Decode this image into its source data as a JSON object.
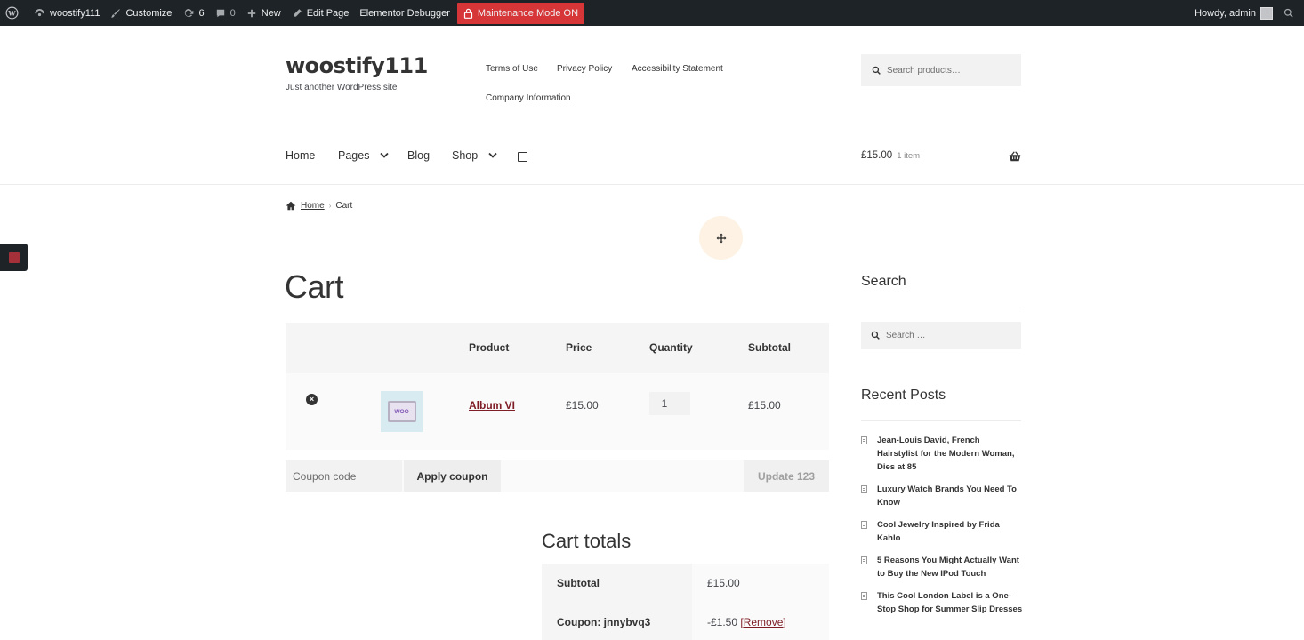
{
  "adminbar": {
    "site_name": "woostify111",
    "customize": "Customize",
    "updates_count": "6",
    "comments_count": "0",
    "new": "New",
    "edit_page": "Edit Page",
    "elementor_debugger": "Elementor Debugger",
    "maintenance": "Maintenance Mode ON",
    "howdy": "Howdy, admin"
  },
  "header": {
    "site_title": "woostify111",
    "tagline": "Just another WordPress site",
    "secondary_nav": [
      "Terms of Use",
      "Privacy Policy",
      "Accessibility Statement",
      "Company Information"
    ],
    "search_placeholder": "Search products…"
  },
  "nav": {
    "home": "Home",
    "pages": "Pages",
    "blog": "Blog",
    "shop": "Shop",
    "cart_amount": "£15.00",
    "cart_count": "1 item"
  },
  "breadcrumb": {
    "home": "Home",
    "current": "Cart"
  },
  "cart": {
    "title": "Cart",
    "columns": {
      "product": "Product",
      "price": "Price",
      "quantity": "Quantity",
      "subtotal": "Subtotal"
    },
    "items": [
      {
        "name": "Album VI",
        "thumb_text": "WOO",
        "price": "£15.00",
        "quantity": "1",
        "subtotal": "£15.00"
      }
    ],
    "coupon_placeholder": "Coupon code",
    "apply_coupon": "Apply coupon",
    "update_cart": "Update 123"
  },
  "totals": {
    "title": "Cart totals",
    "subtotal_label": "Subtotal",
    "subtotal_value": "£15.00",
    "coupon_label": "Coupon: jnnybvq3",
    "coupon_value": "-£1.50",
    "remove_label": "[Remove]"
  },
  "sidebar": {
    "search_title": "Search",
    "search_placeholder": "Search …",
    "recent_title": "Recent Posts",
    "posts": [
      "Jean-Louis David, French Hairstylist for the Modern Woman, Dies at 85",
      "Luxury Watch Brands You Need To Know",
      "Cool Jewelry Inspired by Frida Kahlo",
      "5 Reasons You Might Actually Want to Buy the New IPod Touch",
      "This Cool London Label is a One-Stop Shop for Summer Slip Dresses"
    ]
  },
  "colors": {
    "adminbar": "#1d2327",
    "accent": "#7f1d26",
    "maintenance": "#d63638"
  }
}
